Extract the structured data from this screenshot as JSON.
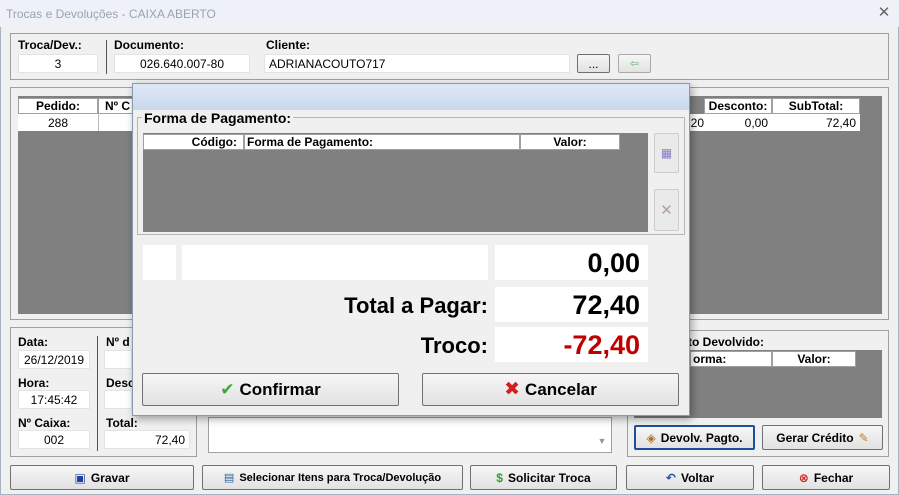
{
  "window": {
    "title": "Trocas e Devoluções - CAIXA ABERTO"
  },
  "header": {
    "troca_label": "Troca/Dev.:",
    "troca_value": "3",
    "documento_label": "Documento:",
    "documento_value": "026.640.007-80",
    "cliente_label": "Cliente:",
    "cliente_value": "ADRIANACOUTO717",
    "browse_label": "..."
  },
  "items_grid": {
    "col_pedido": "Pedido:",
    "col_no": "Nº C",
    "row_pedido": "288",
    "col_desconto": "Desconto:",
    "col_subtotal": "SubTotal:",
    "row_partial": "20",
    "row_desconto": "0,00",
    "row_subtotal": "72,40"
  },
  "info": {
    "data_label": "Data:",
    "data_value": "26/12/2019",
    "hora_label": "Hora:",
    "hora_value": "17:45:42",
    "caixa_label": "Nº Caixa:",
    "caixa_value": "002",
    "nd_label": "Nº d",
    "desc_label": "Desc",
    "total_label": "Total:",
    "total_value": "72,40"
  },
  "right_panel": {
    "title": "to Devolvido:",
    "col_forma": "orma:",
    "col_valor": "Valor:",
    "devolv_button": "Devolv. Pagto.",
    "credito_button": "Gerar Crédito"
  },
  "footer": {
    "gravar": "Gravar",
    "selecionar": "Selecionar Itens para Troca/Devolução",
    "solicitar": "Solicitar Troca",
    "voltar": "Voltar",
    "fechar": "Fechar"
  },
  "modal": {
    "group_title": "Forma de Pagamento:",
    "col_codigo": "Código:",
    "col_forma": "Forma de Pagamento:",
    "col_valor": "Valor:",
    "entry_value": "0,00",
    "total_label": "Total a Pagar:",
    "total_value": "72,40",
    "troco_label": "Troco:",
    "troco_value": "-72,40",
    "confirm_label": "Confirmar",
    "cancel_label": "Cancelar"
  },
  "colors": {
    "troco": "#c00000",
    "gray_area": "#808080",
    "confirm_check": "#3aa83a",
    "cancel_x": "#d02020"
  }
}
